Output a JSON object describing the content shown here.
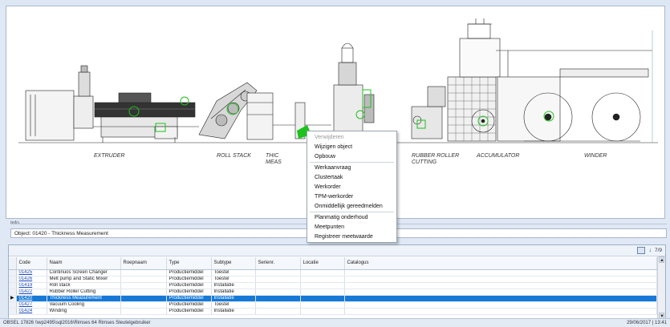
{
  "canvas": {
    "machines": [
      "EXTRUDER",
      "ROLL STACK",
      "THICKNESS MEASUREMENT",
      "RUBBER ROLLER CUTTING",
      "ACCUMULATOR",
      "WINDER"
    ],
    "labels": {
      "extruder": "EXTRUDER",
      "roll_stack": "ROLL STACK",
      "thick_1": "THIC",
      "thick_2": "MEAS",
      "rubber_1": "RUBBER ROLLER",
      "rubber_2": "CUTTING",
      "accumulator": "ACCUMULATOR",
      "winder": "WINDER"
    }
  },
  "context_menu": {
    "items": [
      {
        "label": "Verwijderen",
        "enabled": false
      },
      {
        "label": "Wijzigen object",
        "enabled": true
      },
      {
        "label": "Opbouw",
        "enabled": true
      },
      {
        "label": "Werkaanvraag",
        "enabled": true
      },
      {
        "label": "Clustertaak",
        "enabled": true
      },
      {
        "label": "Werkorder",
        "enabled": true
      },
      {
        "label": "TPM-werkorder",
        "enabled": true
      },
      {
        "label": "Onmiddellijk gereedmelden",
        "enabled": true
      },
      {
        "label": "Planmatig onderhoud",
        "enabled": true
      },
      {
        "label": "Meetpunten",
        "enabled": true
      },
      {
        "label": "Registreer meetwaarde",
        "enabled": true
      }
    ]
  },
  "info": {
    "legend": "Info",
    "object_text": "Object: 01420 - Thickness Measurement"
  },
  "grid": {
    "pager": "7/9",
    "columns": [
      "Code",
      "Naam",
      "Roepnaam",
      "Type",
      "Subtype",
      "Serienr.",
      "Locatie",
      "Catalogus"
    ],
    "rows": [
      {
        "code": "01425",
        "naam": "Continuos  Screen Changer",
        "roepnaam": "",
        "type": "Productiemiddel",
        "subtype": "Toestel",
        "serienr": "",
        "locatie": "",
        "catalogus": "",
        "selected": false
      },
      {
        "code": "01426",
        "naam": "Melt pump and Static Mixer",
        "roepnaam": "",
        "type": "Productiemiddel",
        "subtype": "Toestel",
        "serienr": "",
        "locatie": "",
        "catalogus": "",
        "selected": false
      },
      {
        "code": "01419",
        "naam": "Roll stack",
        "roepnaam": "",
        "type": "Productiemiddel",
        "subtype": "Installatie",
        "serienr": "",
        "locatie": "",
        "catalogus": "",
        "selected": false
      },
      {
        "code": "01422",
        "naam": "Rubber Roller Cutting",
        "roepnaam": "",
        "type": "Productiemiddel",
        "subtype": "Installatie",
        "serienr": "",
        "locatie": "",
        "catalogus": "",
        "selected": false
      },
      {
        "code": "01420",
        "naam": "Thickness Measurement",
        "roepnaam": "",
        "type": "Productiemiddel",
        "subtype": "Installatie",
        "serienr": "",
        "locatie": "",
        "catalogus": "",
        "selected": true
      },
      {
        "code": "01427",
        "naam": "Vacuum Cooling",
        "roepnaam": "",
        "type": "Productiemiddel",
        "subtype": "Toestel",
        "serienr": "",
        "locatie": "",
        "catalogus": "",
        "selected": false
      },
      {
        "code": "01424",
        "naam": "Winding",
        "roepnaam": "",
        "type": "Productiemiddel",
        "subtype": "Installatie",
        "serienr": "",
        "locatie": "",
        "catalogus": "",
        "selected": false
      }
    ]
  },
  "statusbar": {
    "left": "OBSEL 17826   \\\\wp2495\\sql2016\\Rimses 64   Rimses Sleutelgebruiker",
    "right": "29/06/2017 | 13:41"
  },
  "colors": {
    "selection": "#1679d8",
    "highlight_marker": "#1ec21e",
    "link": "#1a47b8"
  }
}
